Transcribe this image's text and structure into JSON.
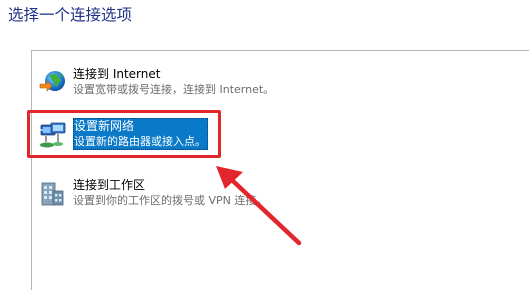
{
  "page": {
    "title": "选择一个连接选项"
  },
  "options": [
    {
      "id": "internet",
      "title": "连接到 Internet",
      "description": "设置宽带或拨号连接，连接到 Internet。",
      "icon": "globe-internet-icon",
      "selected": false
    },
    {
      "id": "new-network",
      "title": "设置新网络",
      "description": "设置新的路由器或接入点。",
      "icon": "network-setup-icon",
      "selected": true
    },
    {
      "id": "workplace",
      "title": "连接到工作区",
      "description": "设置到你的工作区的拨号或 VPN 连接。",
      "icon": "workplace-building-icon",
      "selected": false
    }
  ],
  "annotation": {
    "highlight_color": "#e2272c",
    "points_to": "new-network"
  },
  "colors": {
    "title_text": "#1e3287",
    "selection_background": "#0a7ac8",
    "description_text": "#6d6d6d"
  }
}
